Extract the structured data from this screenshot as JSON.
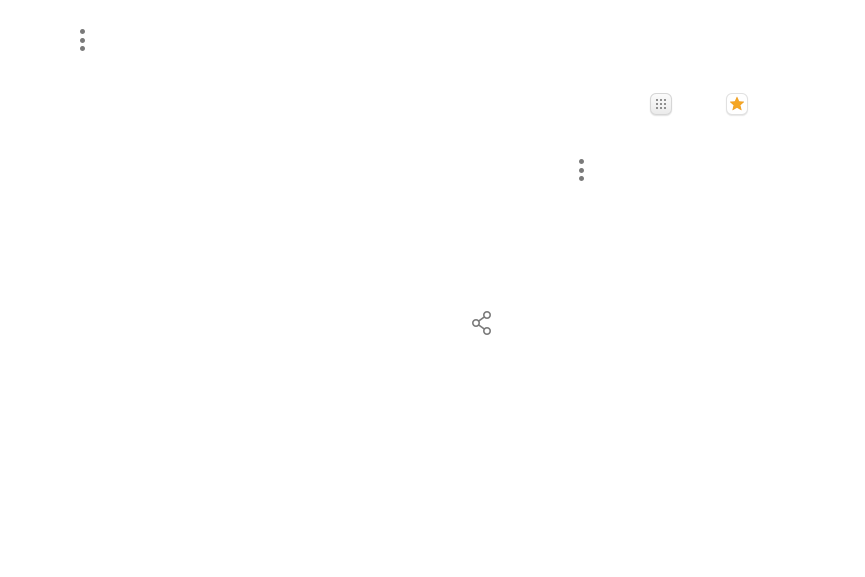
{
  "icons": {
    "more_options_left": "more-options-icon",
    "apps": "apps-grid-icon",
    "galaxy_apps": "galaxy-apps-star-icon",
    "more_options_right": "more-options-icon",
    "share": "share-icon"
  },
  "colors": {
    "icon_gray": "#7a7a7a",
    "star_orange": "#f5a623",
    "background": "#ffffff"
  }
}
